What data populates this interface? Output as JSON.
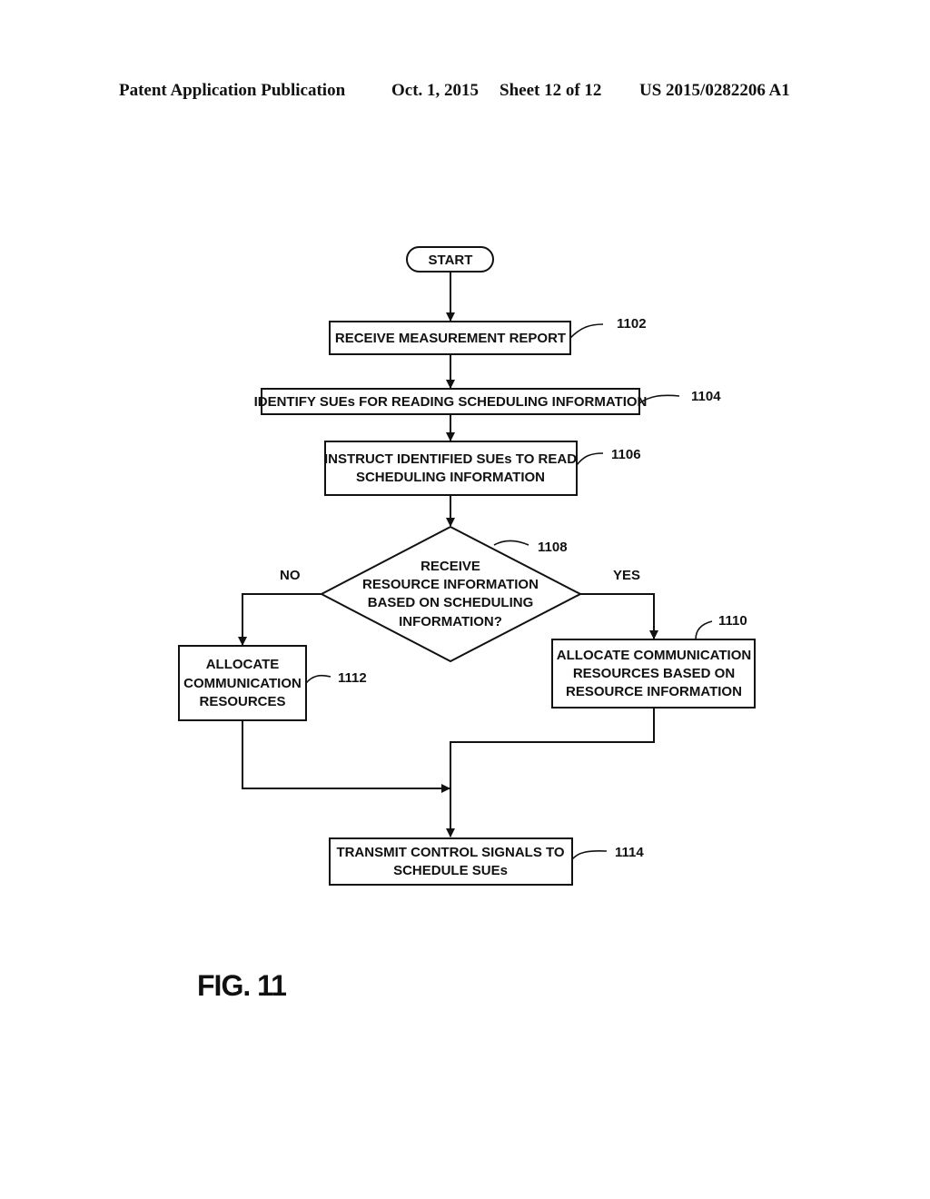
{
  "header": {
    "publication": "Patent Application Publication",
    "date": "Oct. 1, 2015",
    "sheet": "Sheet 12 of 12",
    "number": "US 2015/0282206 A1"
  },
  "flowchart": {
    "start": "START",
    "steps": {
      "s1102": {
        "ref": "1102",
        "lines": [
          "RECEIVE MEASUREMENT REPORT"
        ]
      },
      "s1104": {
        "ref": "1104",
        "lines": [
          "IDENTIFY SUEs FOR READING SCHEDULING INFORMATION"
        ]
      },
      "s1106": {
        "ref": "1106",
        "lines": [
          "INSTRUCT IDENTIFIED SUEs TO READ",
          "SCHEDULING INFORMATION"
        ]
      },
      "s1108": {
        "ref": "1108",
        "lines": [
          "RECEIVE",
          "RESOURCE INFORMATION",
          "BASED ON SCHEDULING",
          "INFORMATION?"
        ]
      },
      "s1110": {
        "ref": "1110",
        "lines": [
          "ALLOCATE COMMUNICATION",
          "RESOURCES BASED ON",
          "RESOURCE INFORMATION"
        ]
      },
      "s1112": {
        "ref": "1112",
        "lines": [
          "ALLOCATE",
          "COMMUNICATION",
          "RESOURCES"
        ]
      },
      "s1114": {
        "ref": "1114",
        "lines": [
          "TRANSMIT CONTROL SIGNALS TO",
          "SCHEDULE SUEs"
        ]
      }
    },
    "branches": {
      "no": "NO",
      "yes": "YES"
    }
  },
  "figure_label": "FIG. 11"
}
